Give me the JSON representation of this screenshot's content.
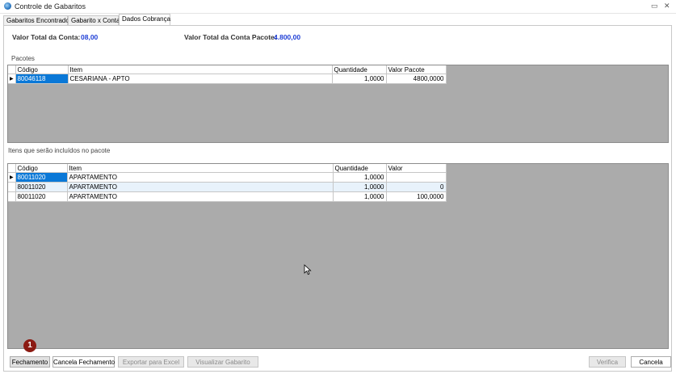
{
  "window": {
    "title": "Controle de Gabaritos",
    "minimize_glyph": "▭",
    "close_glyph": "✕"
  },
  "tabs": [
    {
      "label": "Gabaritos Encontrados"
    },
    {
      "label": "Gabarito x Conta"
    },
    {
      "label": "Dados Cobrança",
      "active": true
    }
  ],
  "totals": {
    "conta_label": "Valor Total da Conta:",
    "conta_value": "08,00",
    "pacote_label": "Valor Total da Conta Pacote:",
    "pacote_value": "4.800,00"
  },
  "pacotes": {
    "section_label": "Pacotes",
    "columns": [
      "Código",
      "Item",
      "Quantidade",
      "Valor Pacote"
    ],
    "rows": [
      {
        "codigo": "80046118",
        "item": "CESARIANA - APTO",
        "quantidade": "1,0000",
        "valor": "4800,0000"
      }
    ]
  },
  "itens": {
    "section_label": "Itens que serão incluídos no pacote",
    "columns": [
      "Código",
      "Item",
      "Quantidade",
      "Valor"
    ],
    "rows": [
      {
        "codigo": "80011020",
        "item": "APARTAMENTO",
        "quantidade": "1,0000",
        "valor": ""
      },
      {
        "codigo": "80011020",
        "item": "APARTAMENTO",
        "quantidade": "1,0000",
        "valor": "0"
      },
      {
        "codigo": "80011020",
        "item": "APARTAMENTO",
        "quantidade": "1,0000",
        "valor": "100,0000"
      }
    ]
  },
  "buttons": {
    "fechamento": "Fechamento",
    "cancela_fechamento": "Cancela Fechamento",
    "exportar_excel": "Exportar para Excel",
    "visualizar_gabarito": "Visualizar Gabarito",
    "verifica": "Verifica",
    "cancela": "Cancela"
  },
  "step_badge": "1",
  "colors": {
    "value_blue": "#1f3fd6",
    "selection_blue": "#0a78d7",
    "grid_background": "#ababab",
    "badge_red": "#8b1a12"
  }
}
